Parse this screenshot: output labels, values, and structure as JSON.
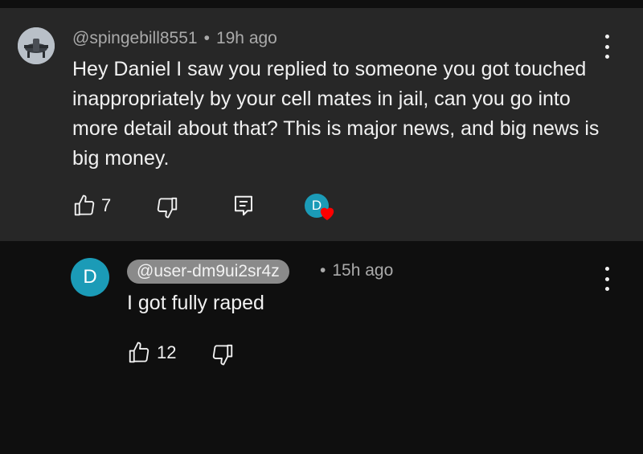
{
  "comment": {
    "author": "@spingebill8551",
    "separator": "•",
    "time": "19h ago",
    "text": "Hey Daniel I saw you replied to someone you got touched inappropriately by your cell mates in jail, can you go into more detail about that? This is major news, and big news is big money.",
    "like_count": "7",
    "creator_heart_initial": "D",
    "icons": [
      "thumbs-up-icon",
      "thumbs-down-icon",
      "reply-icon",
      "creator-heart-icon",
      "more-vert-icon"
    ]
  },
  "reply": {
    "avatar_initial": "D",
    "author": "@user-dm9ui2sr4z",
    "separator": "•",
    "time": "15h ago",
    "text": "I got fully raped",
    "like_count": "12",
    "icons": [
      "thumbs-up-icon",
      "thumbs-down-icon",
      "more-vert-icon"
    ]
  },
  "colors": {
    "comment_bg": "#272727",
    "page_bg": "#0f0f0f",
    "avatar_teal": "#1b9bb7",
    "heart_red": "#ff0000",
    "muted_text": "#aaaaaa",
    "pill_bg": "#8a8a8a"
  }
}
